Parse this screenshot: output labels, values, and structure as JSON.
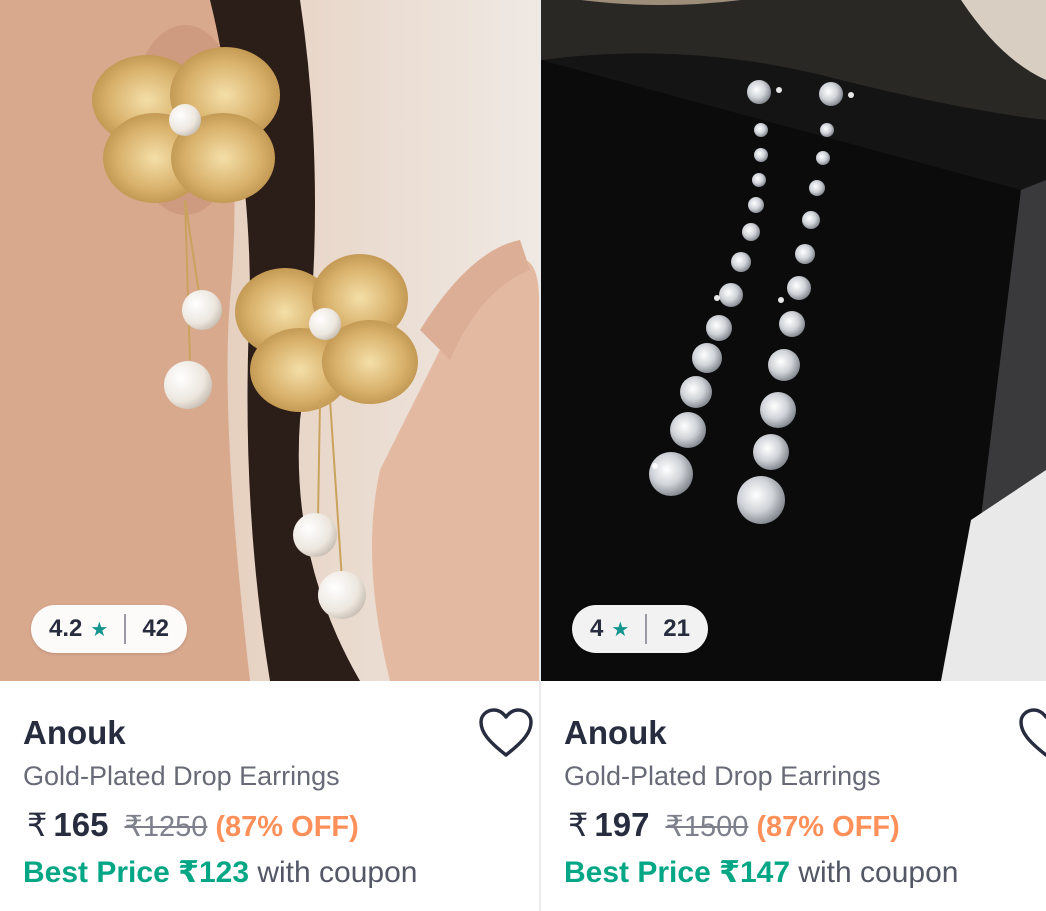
{
  "products": [
    {
      "rating": "4.2",
      "rating_count": "42",
      "brand": "Anouk",
      "name": "Gold-Plated Drop Earrings",
      "currency": "₹",
      "price": "165",
      "mrp": "₹1250",
      "discount": "(87% OFF)",
      "best_price_label": "Best Price ₹123",
      "best_price_suffix": " with coupon",
      "image_icon": "gold-flower-pearl-earrings-image"
    },
    {
      "rating": "4",
      "rating_count": "21",
      "brand": "Anouk",
      "name": "Gold-Plated Drop Earrings",
      "currency": "₹",
      "price": "197",
      "mrp": "₹1500",
      "discount": "(87% OFF)",
      "best_price_label": "Best Price ₹147",
      "best_price_suffix": " with coupon",
      "image_icon": "crystal-linear-drop-earrings-image"
    }
  ],
  "icons": {
    "star": "★",
    "wishlist": "heart-outline-icon"
  },
  "colors": {
    "rating_star": "#14958f",
    "discount": "#ff905a",
    "best_price": "#03a685",
    "text_primary": "#282c3f",
    "text_secondary": "#686b77"
  }
}
